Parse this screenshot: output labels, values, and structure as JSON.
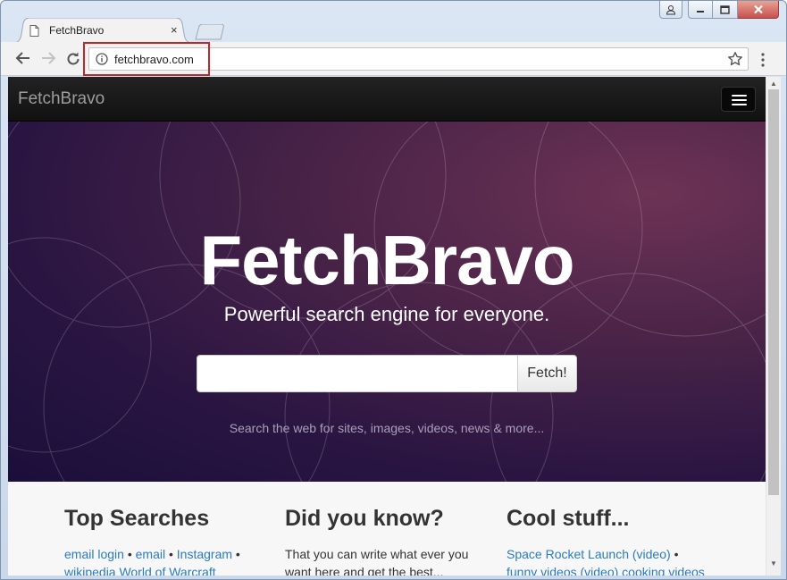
{
  "browser": {
    "tab_title": "FetchBravo",
    "tab_close": "×",
    "url": "fetchbravo.com"
  },
  "navbar": {
    "brand": "FetchBravo"
  },
  "hero": {
    "title": "FetchBravo",
    "subtitle": "Powerful search engine for everyone.",
    "search_placeholder": "",
    "search_button": "Fetch!",
    "hint": "Search the web for sites, images, videos, news & more..."
  },
  "sections": {
    "top_searches": {
      "heading": "Top Searches",
      "links": [
        "email login",
        "email",
        "Instagram"
      ],
      "cut_line": "wikipedia  World of Warcraft"
    },
    "did_you_know": {
      "heading": "Did you know?",
      "line1": "That you can write what ever you",
      "line2": "want here and get the best..."
    },
    "cool_stuff": {
      "heading": "Cool stuff...",
      "links": [
        "Space Rocket Launch (video)"
      ],
      "cut_line": "funny videos (video)  cooking videos"
    }
  },
  "colors": {
    "link": "#2a7bc0",
    "highlight_box": "#c0272d",
    "navbar": "#111111"
  }
}
